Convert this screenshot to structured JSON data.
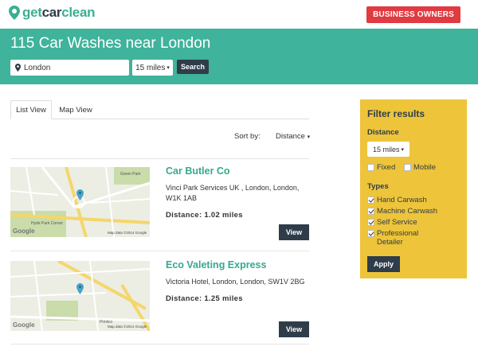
{
  "header": {
    "logo_text_part1": "get",
    "logo_text_part2": "car",
    "logo_text_part3": "clean",
    "business_button": "BUSINESS OWNERS"
  },
  "hero": {
    "title": "115 Car Washes near London",
    "location_value": "London",
    "distance_value": "15 miles",
    "search_label": "Search"
  },
  "tabs": [
    {
      "label": "List View",
      "active": true
    },
    {
      "label": "Map View",
      "active": false
    }
  ],
  "sort": {
    "label": "Sort by:",
    "value": "Distance"
  },
  "listings": [
    {
      "name": "Car Butler Co",
      "address": "Vinci Park Services UK , London, London, W1K 1AB",
      "distance": "Distance: 1.02 miles",
      "view_label": "View",
      "map_credit": "Map data ©2014 Google",
      "map_labels": [
        "Green Park",
        "Hyde Park Corner",
        "Google"
      ]
    },
    {
      "name": "Eco Valeting Express",
      "address": "Victoria Hotel, London, London, SW1V 2BG",
      "distance": "Distance: 1.25 miles",
      "view_label": "View",
      "map_credit": "Map data ©2014 Google",
      "map_labels": [
        "Pimlico",
        "Google"
      ]
    }
  ],
  "filter": {
    "title": "Filter results",
    "distance_label": "Distance",
    "distance_value": "15 miles",
    "options": [
      {
        "label": "Fixed",
        "checked": false
      },
      {
        "label": "Mobile",
        "checked": false
      }
    ],
    "types_label": "Types",
    "types": [
      {
        "label": "Hand Carwash",
        "checked": true
      },
      {
        "label": "Machine Carwash",
        "checked": true
      },
      {
        "label": "Self Service",
        "checked": true
      },
      {
        "label": "Professional Detailer",
        "checked": true
      }
    ],
    "apply_label": "Apply"
  },
  "colors": {
    "teal": "#3fb39b",
    "navy": "#2f3d4a",
    "red": "#e13a40",
    "yellow": "#eec43a"
  }
}
